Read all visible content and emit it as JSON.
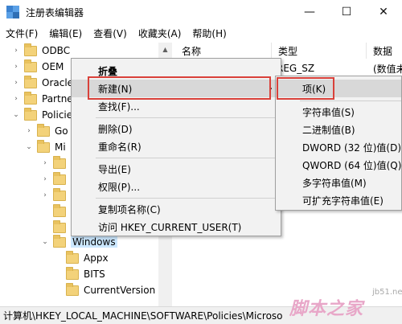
{
  "window": {
    "title": "注册表编辑器",
    "minimize": "—",
    "maximize": "☐",
    "close": "✕"
  },
  "menubar": [
    "文件(F)",
    "编辑(E)",
    "查看(V)",
    "收藏夹(A)",
    "帮助(H)"
  ],
  "tree": [
    {
      "label": "ODBC",
      "expander": "›"
    },
    {
      "label": "OEM",
      "expander": "›"
    },
    {
      "label": "Oracle",
      "expander": "›"
    },
    {
      "label": "Partne",
      "expander": "›"
    },
    {
      "label": "Policie",
      "expander": "⌄"
    },
    {
      "label": "Go",
      "expander": "›"
    },
    {
      "label": "Mi",
      "expander": "⌄"
    },
    {
      "label": "",
      "expander": "›"
    },
    {
      "label": "",
      "expander": "›"
    },
    {
      "label": "",
      "expander": "›"
    },
    {
      "label": "",
      "expander": ""
    },
    {
      "label": "",
      "expander": ""
    },
    {
      "label": "Windows",
      "expander": "⌄"
    },
    {
      "label": "Appx",
      "expander": ""
    },
    {
      "label": "BITS",
      "expander": ""
    },
    {
      "label": "CurrentVersion",
      "expander": ""
    }
  ],
  "columns": {
    "name": "名称",
    "type": "类型",
    "data": "数据"
  },
  "values": [
    {
      "type": "REG_SZ",
      "data": "(数值未"
    }
  ],
  "context_menu": [
    "折叠",
    "新建(N)",
    "查找(F)...",
    "删除(D)",
    "重命名(R)",
    "导出(E)",
    "权限(P)...",
    "复制项名称(C)",
    "访问 HKEY_CURRENT_USER(T)"
  ],
  "submenu_arrow": "›",
  "submenu": [
    "项(K)",
    "字符串值(S)",
    "二进制值(B)",
    "DWORD (32 位)值(D)",
    "QWORD (64 位)值(Q)",
    "多字符串值(M)",
    "可扩充字符串值(E)"
  ],
  "statusbar": "计算机\\HKEY_LOCAL_MACHINE\\SOFTWARE\\Policies\\Microso",
  "watermark": {
    "site": "jb51.net",
    "brand": "脚本之家"
  },
  "colors": {
    "highlight": "#d9413a",
    "selection": "#cce8ff",
    "menu_bg": "#f2f2f2"
  }
}
